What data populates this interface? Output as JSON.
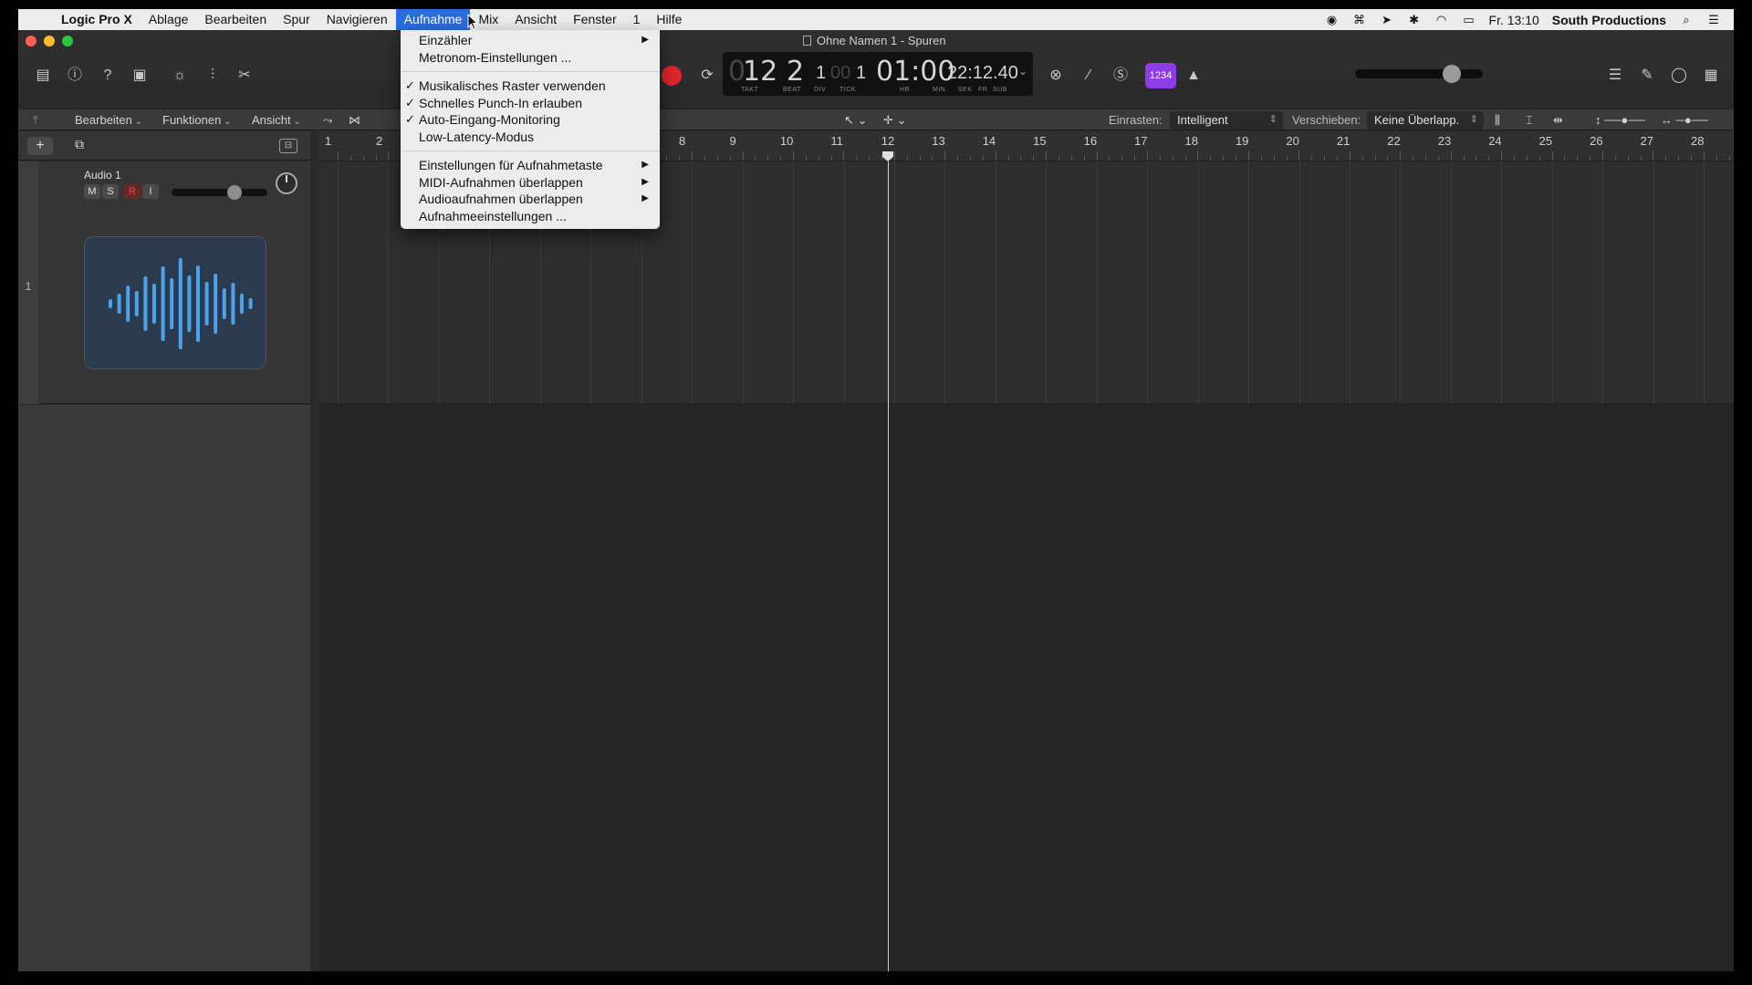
{
  "menubar": {
    "items": [
      "Logic Pro X",
      "Ablage",
      "Bearbeiten",
      "Spur",
      "Navigieren",
      "Aufnahme",
      "Mix",
      "Ansicht",
      "Fenster",
      "1",
      "Hilfe"
    ],
    "clock": "Fr. 13:10",
    "user": "South Productions"
  },
  "window": {
    "title": "Ohne Namen 1 - Spuren"
  },
  "lcd": {
    "bar": "12",
    "beat": "2",
    "div": "1",
    "tick": "1",
    "time_hm": "01:00",
    "time_rest": "22:12.40",
    "labels": {
      "takt": "TAKT",
      "beat": "BEAT",
      "div": "DIV",
      "tick": "TICK",
      "hr": "HR",
      "min": "MIN",
      "sek": "SEK",
      "fr": "FR",
      "sub": "SUB"
    }
  },
  "count_in_badge": "1234",
  "tracks_toolbar": {
    "bearbeiten": "Bearbeiten",
    "funktionen": "Funktionen",
    "ansicht": "Ansicht",
    "einrasten_label": "Einrasten:",
    "einrasten_value": "Intelligent",
    "verschieben_label": "Verschieben:",
    "verschieben_value": "Keine Überlapp."
  },
  "track": {
    "number": "1",
    "name": "Audio 1",
    "buttons": {
      "m": "M",
      "s": "S",
      "r": "R",
      "i": "I"
    },
    "volume_level": 0.68
  },
  "ruler": {
    "bars": [
      "1",
      "2",
      "8",
      "9",
      "10",
      "11",
      "12",
      "13",
      "14",
      "15",
      "16",
      "17",
      "18",
      "19",
      "20",
      "21",
      "22",
      "23",
      "24",
      "25",
      "26",
      "27",
      "28"
    ]
  },
  "dropdown": {
    "group1": [
      {
        "label": "Einzähler",
        "submenu": true
      },
      {
        "label": "Metronom-Einstellungen ..."
      }
    ],
    "group2": [
      {
        "label": "Musikalisches Raster verwenden",
        "checked": true
      },
      {
        "label": "Schnelles Punch-In erlauben",
        "checked": true
      },
      {
        "label": "Auto-Eingang-Monitoring",
        "checked": true
      },
      {
        "label": "Low-Latency-Modus"
      }
    ],
    "group3": [
      {
        "label": "Einstellungen für Aufnahmetaste",
        "submenu": true
      },
      {
        "label": "MIDI-Aufnahmen überlappen",
        "submenu": true
      },
      {
        "label": "Audioaufnahmen überlappen",
        "submenu": true
      },
      {
        "label": "Aufnahmeeinstellungen ..."
      }
    ]
  },
  "colors": {
    "accent": "#2a6ce0",
    "record": "#e0252b",
    "count_in": "#8e3ce6",
    "waveform": "#4ea3e8"
  }
}
